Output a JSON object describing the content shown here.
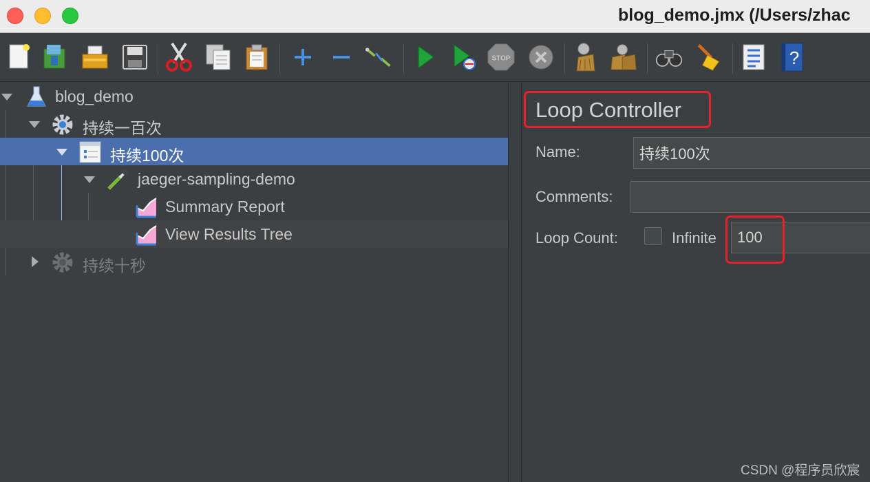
{
  "window": {
    "title": "blog_demo.jmx (/Users/zhac"
  },
  "toolbar": {
    "icons": [
      "new-icon",
      "templates-icon",
      "open-icon",
      "save-icon",
      "cut-icon",
      "copy-icon",
      "paste-icon",
      "expand-icon",
      "collapse-icon",
      "toggle-icon",
      "start-icon",
      "start-no-pauses-icon",
      "stop-icon",
      "shutdown-icon",
      "clear-icon",
      "clear-all-icon",
      "search-icon",
      "reset-search-icon",
      "function-helper-icon",
      "help-icon"
    ],
    "stop_label": "STOP"
  },
  "tree": {
    "root": "blog_demo",
    "thread_group_1": "持续一百次",
    "loop_controller": "持续100次",
    "sampler": "jaeger-sampling-demo",
    "listener_1": "Summary Report",
    "listener_2": "View Results Tree",
    "thread_group_2": "持续十秒"
  },
  "panel": {
    "title": "Loop Controller",
    "name_label": "Name:",
    "name_value": "持续100次",
    "comments_label": "Comments:",
    "comments_value": "",
    "loop_count_label": "Loop Count:",
    "infinite_label": "Infinite",
    "infinite_checked": false,
    "loop_count_value": "100"
  },
  "watermark": "CSDN @程序员欣宸",
  "colors": {
    "selection": "#4b6eaf",
    "annotation": "#e8212a",
    "background": "#3c3f41"
  }
}
